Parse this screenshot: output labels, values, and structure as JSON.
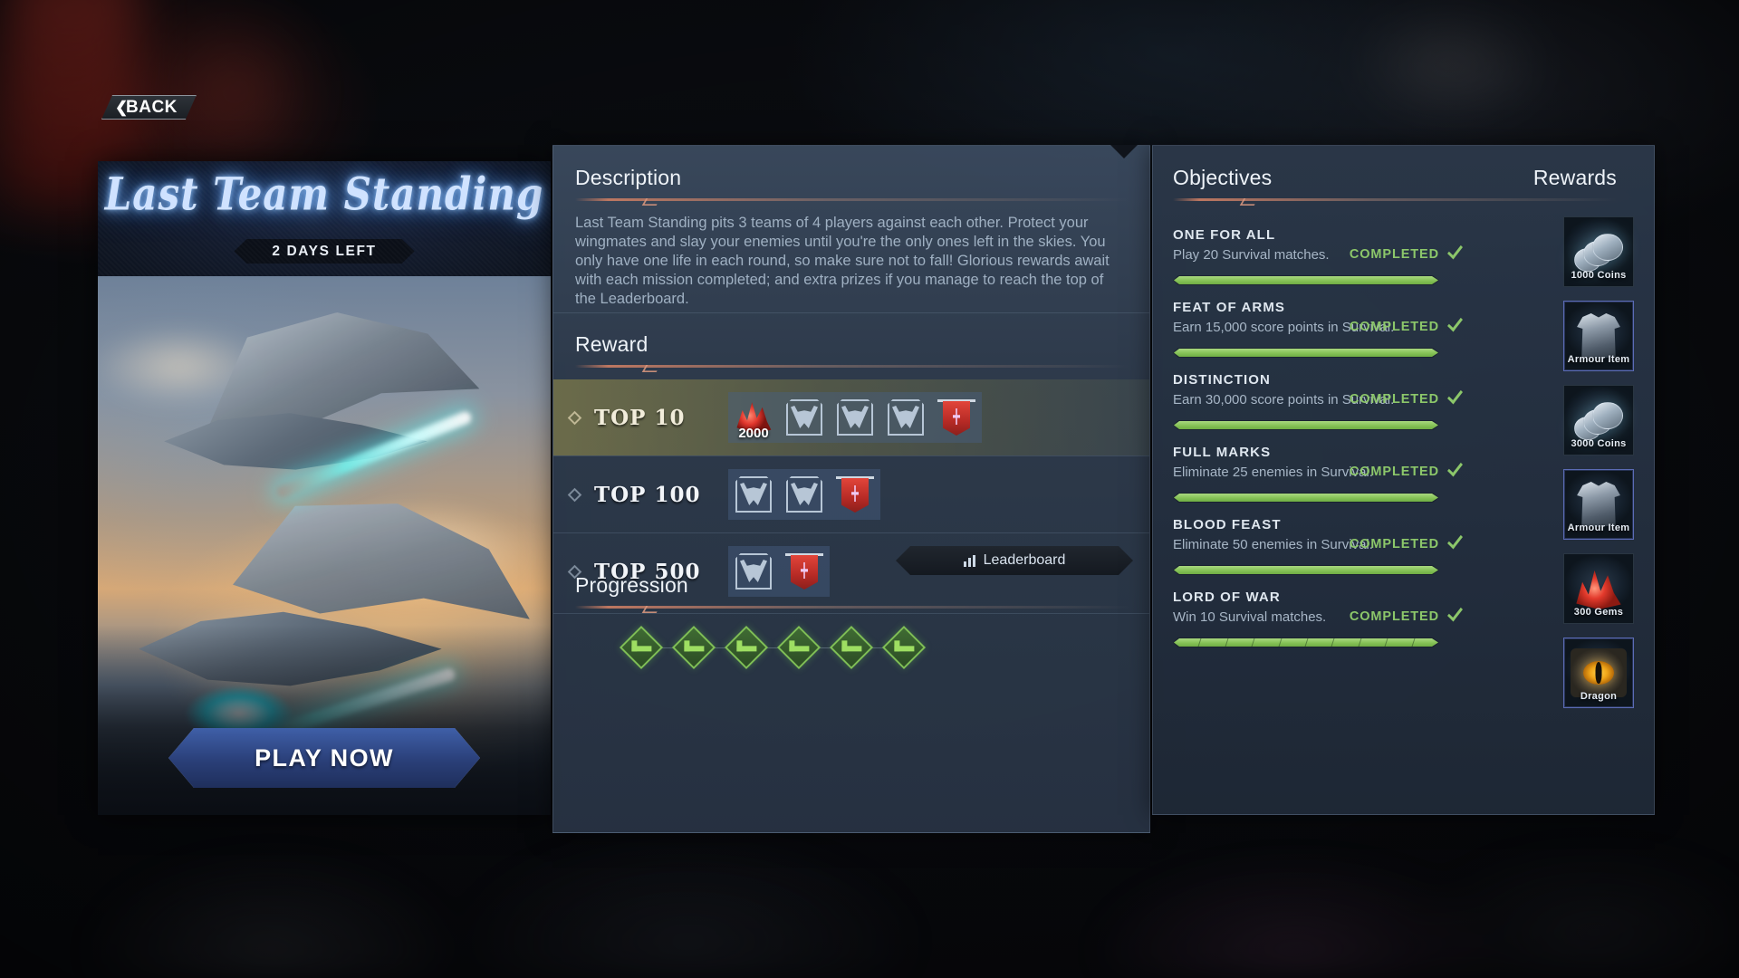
{
  "nav": {
    "back_label": "BACK",
    "back_icon": "double-chevron-left-icon"
  },
  "event_card": {
    "title": "Last Team Standing",
    "time_left": "2 DAYS LEFT",
    "play_label": "PLAY NOW",
    "artwork_name": "dragon-battle-artwork"
  },
  "description": {
    "heading": "Description",
    "body": "Last Team Standing pits 3 teams of 4 players against each other. Protect your wingmates and slay your enemies until you're the only ones left in the skies. You only have one life in each round, so make sure not to fall! Glorious rewards await with each mission completed; and extra prizes if you manage to reach the top of the Leaderboard."
  },
  "reward": {
    "heading": "Reward",
    "leaderboard_label": "Leaderboard",
    "leaderboard_icon": "bar-chart-icon",
    "tiers": [
      {
        "rank": "TOP 10",
        "highlighted": true,
        "items": [
          {
            "icon": "gem-icon",
            "count": "2000"
          },
          {
            "icon": "helmet-icon",
            "count": ""
          },
          {
            "icon": "helmet-icon",
            "count": ""
          },
          {
            "icon": "helmet-icon",
            "count": ""
          },
          {
            "icon": "banner-icon",
            "count": ""
          }
        ]
      },
      {
        "rank": "TOP 100",
        "highlighted": false,
        "items": [
          {
            "icon": "helmet-icon",
            "count": ""
          },
          {
            "icon": "helmet-icon",
            "count": ""
          },
          {
            "icon": "banner-icon",
            "count": ""
          }
        ]
      },
      {
        "rank": "TOP 500",
        "highlighted": false,
        "items": [
          {
            "icon": "helmet-icon",
            "count": ""
          },
          {
            "icon": "banner-icon",
            "count": ""
          }
        ]
      }
    ]
  },
  "progression": {
    "heading": "Progression",
    "nodes": [
      {
        "state": "completed"
      },
      {
        "state": "completed"
      },
      {
        "state": "completed"
      },
      {
        "state": "completed"
      },
      {
        "state": "completed"
      },
      {
        "state": "completed"
      }
    ]
  },
  "objectives": {
    "heading": "Objectives",
    "rewards_heading": "Rewards",
    "items": [
      {
        "name": "ONE FOR ALL",
        "description": "Play 20 Survival matches.",
        "status": "COMPLETED",
        "progress_percent": 100,
        "segments": 1,
        "reward": {
          "label": "1000 Coins",
          "icon": "coins-icon",
          "accent": false
        }
      },
      {
        "name": "FEAT OF ARMS",
        "description": "Earn 15,000 score points in Survival.",
        "status": "COMPLETED",
        "progress_percent": 100,
        "segments": 1,
        "reward": {
          "label": "Armour Item",
          "icon": "armour-icon",
          "accent": true
        }
      },
      {
        "name": "DISTINCTION",
        "description": "Earn 30,000 score points in Survival.",
        "status": "COMPLETED",
        "progress_percent": 100,
        "segments": 1,
        "reward": {
          "label": "3000 Coins",
          "icon": "coins-icon",
          "accent": false
        }
      },
      {
        "name": "FULL MARKS",
        "description": "Eliminate 25 enemies in Survival.",
        "status": "COMPLETED",
        "progress_percent": 100,
        "segments": 1,
        "reward": {
          "label": "Armour Item",
          "icon": "armour-icon",
          "accent": true
        }
      },
      {
        "name": "BLOOD FEAST",
        "description": "Eliminate 50 enemies in Survival.",
        "status": "COMPLETED",
        "progress_percent": 100,
        "segments": 1,
        "reward": {
          "label": "300 Gems",
          "icon": "gems-icon",
          "accent": false
        }
      },
      {
        "name": "LORD OF WAR",
        "description": "Win 10 Survival matches.",
        "status": "COMPLETED",
        "progress_percent": 100,
        "segments": 10,
        "reward": {
          "label": "Dragon",
          "icon": "dragon-eye-icon",
          "accent": true
        }
      }
    ]
  },
  "colors": {
    "accent_green": "#8cc76a",
    "panel_blue": "#3c4c61",
    "rule_copper": "#c47a62",
    "title_glow": "#8fc2ff",
    "highlight_olive": "#807c4a"
  }
}
